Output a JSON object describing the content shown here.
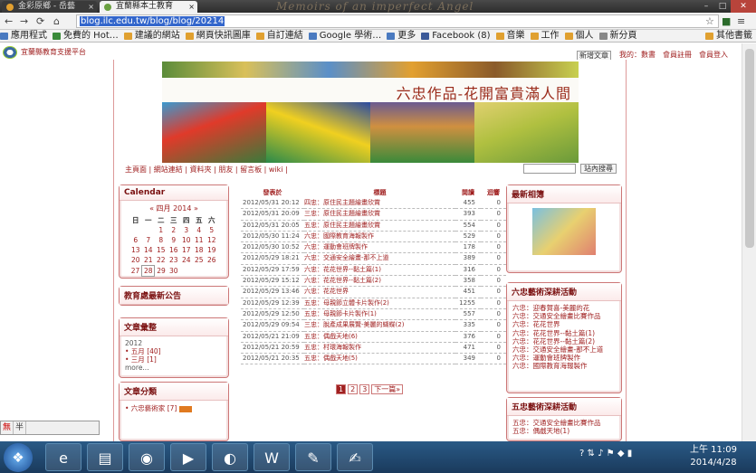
{
  "browser": {
    "tabs": [
      {
        "title": "金彩原鄉 - 岳藝"
      },
      {
        "title": "宜蘭縣本土教育"
      }
    ],
    "banner": "Memoirs of an imperfect Angel",
    "url": "blog.ilc.edu.tw/blog/blog/20214",
    "bookmarks": [
      "應用程式",
      "免費的 Hot…",
      "建議的網站",
      "網頁快訊圖庫",
      "自訂連結",
      "Google 學術…",
      "更多",
      "Facebook (8)",
      "音樂",
      "工作",
      "個人",
      "新分頁"
    ],
    "other_bookmarks": "其他書籤"
  },
  "site": {
    "logo": "宜蘭縣教育支援平台",
    "new_post": "新增文章",
    "top_links": [
      "我的：數書",
      "會員註冊",
      "會員登入"
    ],
    "title": "六忠作品-花開富貴滿人間",
    "menu": "主頁面 | 網站連結 | 資料夾 | 朋友 | 留言板 | wiki |",
    "search_button": "站內搜尋"
  },
  "calendar": {
    "title": "Calendar",
    "month": "«       四月 2014       »",
    "weekdays": [
      "日",
      "一",
      "二",
      "三",
      "四",
      "五",
      "六"
    ],
    "weeks": [
      [
        "",
        "",
        "1",
        "2",
        "3",
        "4",
        "5"
      ],
      [
        "6",
        "7",
        "8",
        "9",
        "10",
        "11",
        "12"
      ],
      [
        "13",
        "14",
        "15",
        "16",
        "17",
        "18",
        "19"
      ],
      [
        "20",
        "21",
        "22",
        "23",
        "24",
        "25",
        "26"
      ],
      [
        "27",
        "28",
        "29",
        "30",
        "",
        "",
        ""
      ]
    ]
  },
  "news": {
    "title": "教育處最新公告"
  },
  "archive": {
    "title": "文章彙整",
    "items": [
      "2012",
      "• 五月 [40]",
      "• 三月 [1]",
      "more..."
    ]
  },
  "categories": {
    "title": "文章分類",
    "items": [
      "• 六忠藝術家 [7]"
    ]
  },
  "posts": {
    "headers": [
      "發表於",
      "標題",
      "閱讀",
      "迴響"
    ],
    "rows": [
      [
        "2012/05/31 20:12",
        "四忠：原住民主題繪畫欣賞",
        "455",
        "0"
      ],
      [
        "2012/05/31 20:09",
        "三忠：原住民主題繪畫欣賞",
        "393",
        "0"
      ],
      [
        "2012/05/31 20:05",
        "五忠：原住民主題繪畫欣賞",
        "554",
        "0"
      ],
      [
        "2012/05/30 11:24",
        "六忠：國際教育海報製作",
        "529",
        "0"
      ],
      [
        "2012/05/30 10:52",
        "六忠：運動會班牌製作",
        "178",
        "0"
      ],
      [
        "2012/05/29 18:21",
        "六忠：交通安全繪畫-那不上道",
        "389",
        "0"
      ],
      [
        "2012/05/29 17:59",
        "六忠：花花世界--黏土篇(1)",
        "316",
        "0"
      ],
      [
        "2012/05/29 15:12",
        "六忠：花花世界--黏土篇(2)",
        "358",
        "0"
      ],
      [
        "2012/05/29 13:46",
        "六忠：花花世界",
        "451",
        "0"
      ],
      [
        "2012/05/29 12:39",
        "五忠：母親節立體卡片製作(2)",
        "1255",
        "0"
      ],
      [
        "2012/05/29 12:50",
        "五忠：母親節卡片製作(1)",
        "557",
        "0"
      ],
      [
        "2012/05/29 09:54",
        "三忠：脫產成果展覽-美麗的蝴蝶(2)",
        "335",
        "0"
      ],
      [
        "2012/05/21 21:09",
        "五忠：偶戲天地(6)",
        "376",
        "0"
      ],
      [
        "2012/05/21 20:59",
        "五忠：村環海報製作",
        "471",
        "0"
      ],
      [
        "2012/05/21 20:35",
        "五忠：偶戲天地(5)",
        "349",
        "0"
      ]
    ]
  },
  "pager": {
    "pages": [
      "1",
      "2",
      "3"
    ],
    "next": "下一篇»"
  },
  "photos": {
    "title": "最新相簿"
  },
  "activity1": {
    "title": "六忠藝術深耕活動",
    "items": [
      "六忠：迎春賀喜-美麗的花",
      "六忠：交通安全繪畫比賽作品",
      "六忠：花花世界",
      "六忠：花花世界--黏土篇(1)",
      "六忠：花花世界--黏土篇(2)",
      "六忠：交通安全繪畫-那不上道",
      "六忠：運動會班牌製作",
      "六忠：國際教育海報製作"
    ]
  },
  "activity2": {
    "title": "五忠藝術深耕活動",
    "items": [
      "五忠：交通安全繪畫比賽作品",
      "五忠：偶戲天地(1)"
    ]
  },
  "ime": [
    "無",
    "半"
  ],
  "clock": {
    "time": "上午 11:09",
    "date": "2014/4/28"
  }
}
